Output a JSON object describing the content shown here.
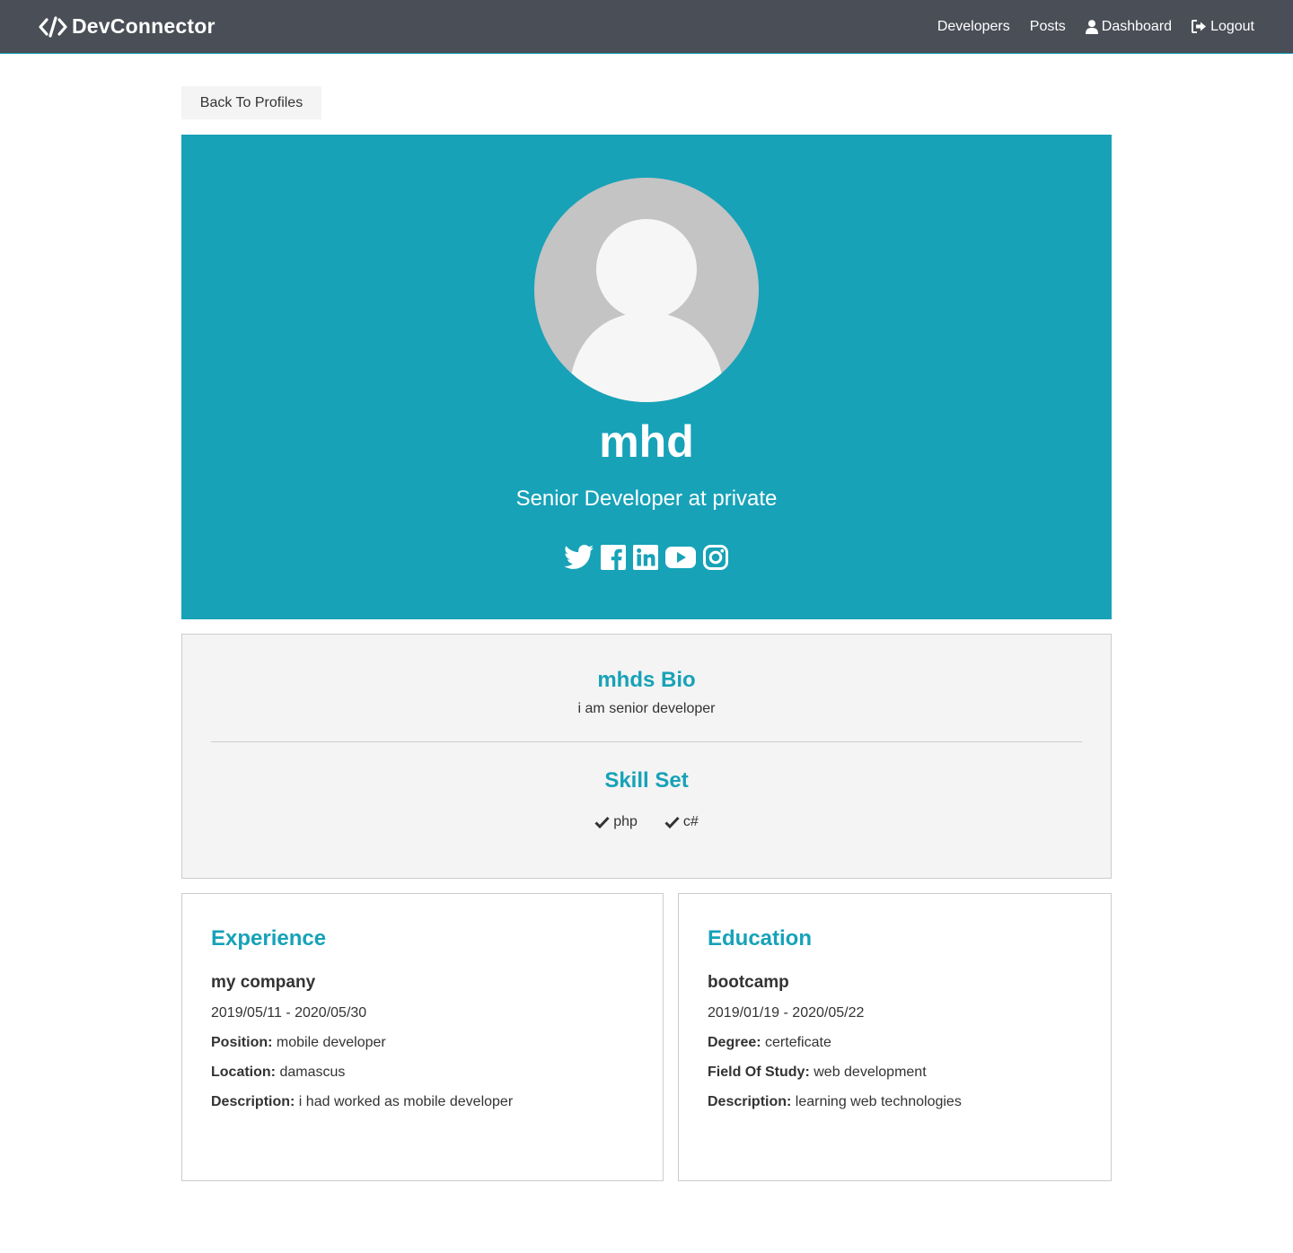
{
  "nav": {
    "brand": "DevConnector",
    "links": [
      {
        "label": "Developers",
        "icon": ""
      },
      {
        "label": "Posts",
        "icon": ""
      },
      {
        "label": "Dashboard",
        "icon": "user-icon"
      },
      {
        "label": "Logout",
        "icon": "sign-out-icon"
      }
    ]
  },
  "back_button": "Back To Profiles",
  "profile": {
    "name": "mhd",
    "status": "Senior Developer at private",
    "socials": [
      "twitter-icon",
      "facebook-icon",
      "linkedin-icon",
      "youtube-icon",
      "instagram-icon"
    ]
  },
  "about": {
    "bio_title": "mhds Bio",
    "bio": "i am senior developer",
    "skills_title": "Skill Set",
    "skills": [
      "php",
      "c#"
    ]
  },
  "experience": {
    "title": "Experience",
    "company": "my company",
    "dates": "2019/05/11 - 2020/05/30",
    "position_label": "Position:",
    "position": "mobile developer",
    "location_label": "Location:",
    "location": "damascus",
    "description_label": "Description:",
    "description": "i had worked as mobile developer"
  },
  "education": {
    "title": "Education",
    "school": "bootcamp",
    "dates": "2019/01/19 - 2020/05/22",
    "degree_label": "Degree:",
    "degree": "certeficate",
    "field_label": "Field Of Study:",
    "field": "web development",
    "description_label": "Description:",
    "description": "learning web technologies"
  },
  "colors": {
    "primary": "#17a2b8",
    "navbar": "#4a4e56",
    "light": "#f4f4f4",
    "text": "#333333"
  }
}
